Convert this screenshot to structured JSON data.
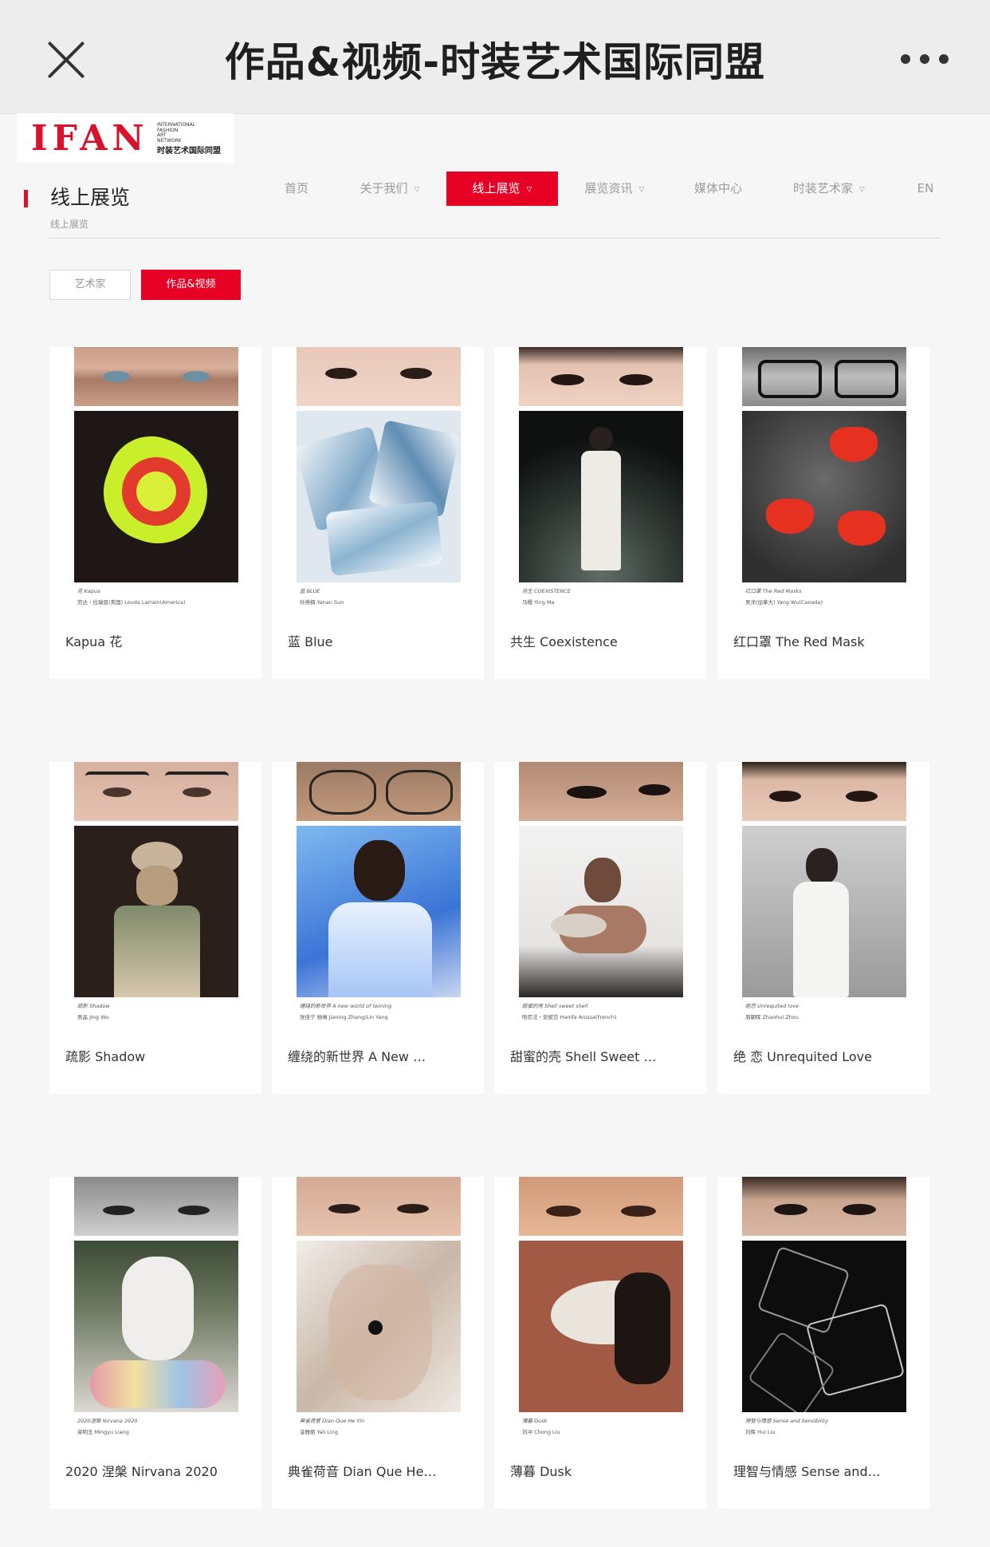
{
  "appbar": {
    "title": "作品&视频-时装艺术国际同盟"
  },
  "logo": {
    "mark": "IFAN",
    "lines": [
      "INTERNATIONAL",
      "FASHION",
      "ART",
      "NETWORK"
    ],
    "cn": "时装艺术国际同盟"
  },
  "page": {
    "heading": "线上展览",
    "breadcrumb": "线上展览"
  },
  "nav": [
    {
      "label": "首页"
    },
    {
      "label": "关于我们"
    },
    {
      "label": "线上展览"
    },
    {
      "label": "展览资讯"
    },
    {
      "label": "媒体中心"
    },
    {
      "label": "时装艺术家"
    },
    {
      "label": "EN"
    }
  ],
  "filters": {
    "artist": "艺术家",
    "works": "作品&视频"
  },
  "colors": {
    "accent": "#e60023"
  },
  "cards": [
    {
      "title": "Kapua 花",
      "cap1": "花 Kapua",
      "cap2": "劳达・拉瑞恩(美国) Louda Larrain(America)"
    },
    {
      "title": "蓝 Blue",
      "cap1": "蓝 BLUE",
      "cap2": "孙燕楠 Yanan Sun"
    },
    {
      "title": "共生 Coexistence",
      "cap1": "共生 COEXISTENCE",
      "cap2": "马樱 Ying Ma"
    },
    {
      "title": "红口罩 The Red Mask",
      "cap1": "红口罩 The Red Masks",
      "cap2": "吴洋(加拿大) Yang Wu(Canada)"
    },
    {
      "title": "疏影 Shadow",
      "cap1": "疏影 Shadow",
      "cap2": "吴晶 Jing Wu"
    },
    {
      "title": "缠绕的新世界 A New …",
      "cap1": "缠绕的新世界 A new world of twining",
      "cap2": "张佳宁 杨琳 Jianing Zhang/Lin Yang"
    },
    {
      "title": "甜蜜的壳 Shell Sweet …",
      "cap1": "甜蜜的壳 Shell sweet shell",
      "cap2": "哈尼法・安妮莎 Hanifa Anissa(French)"
    },
    {
      "title": "绝 恋 Unrequited Love",
      "cap1": "绝恋 Unrequited love",
      "cap2": "周朝晖 Zhaohui Zhou"
    },
    {
      "title": "2020 涅槃 Nirvana 2020",
      "cap1": "2020涅槃 Nirvana 2020",
      "cap2": "梁明玉 Mingyu Liang"
    },
    {
      "title": "典雀荷音 Dian Que He…",
      "cap1": "典雀荷音 Dian Que He Yin",
      "cap2": "凌雅丽 Yali Ling"
    },
    {
      "title": "薄暮 Dusk",
      "cap1": "薄暮 Dusk",
      "cap2": "刘冲 Chong Liu"
    },
    {
      "title": "理智与情感 Sense and…",
      "cap1": "理智与情感 Sense and Sensibility",
      "cap2": "刘晖 Hui Liu"
    }
  ]
}
